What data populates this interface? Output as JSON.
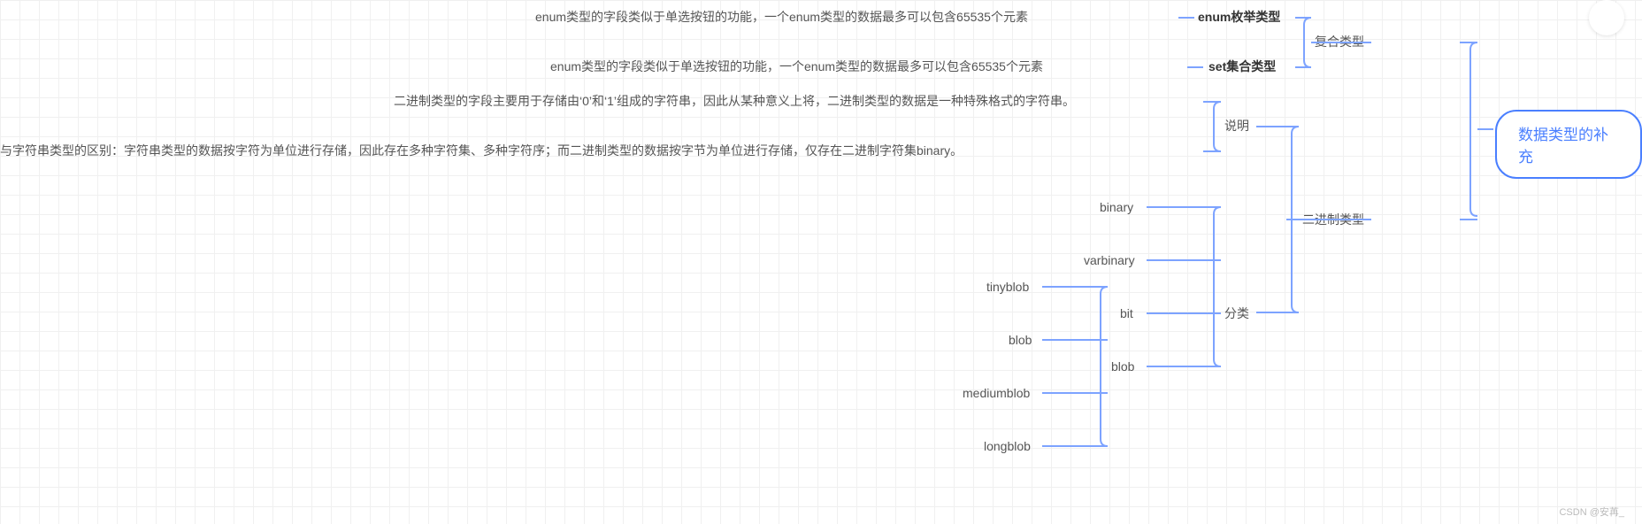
{
  "root": "数据类型的补充",
  "composite": {
    "label": "复合类型",
    "enum": {
      "label": "enum枚举类型",
      "desc": "enum类型的字段类似于单选按钮的功能，一个enum类型的数据最多可以包含65535个元素"
    },
    "set": {
      "label": "set集合类型",
      "desc": "enum类型的字段类似于单选按钮的功能，一个enum类型的数据最多可以包含65535个元素"
    }
  },
  "binary": {
    "label": "二进制类型",
    "explain": {
      "label": "说明",
      "desc1": "二进制类型的字段主要用于存储由‘0’和‘1’组成的字符串，因此从某种意义上将，二进制类型的数据是一种特殊格式的字符串。",
      "desc2": "与字符串类型的区别：字符串类型的数据按字符为单位进行存储，因此存在多种字符集、多种字符序；而二进制类型的数据按字节为单位进行存储，仅存在二进制字符集binary。"
    },
    "classify": {
      "label": "分类",
      "items": {
        "binary": "binary",
        "varbinary": "varbinary",
        "bit": "bit",
        "blob": {
          "label": "blob",
          "items": {
            "tinyblob": "tinyblob",
            "blob": "blob",
            "mediumblob": "mediumblob",
            "longblob": "longblob"
          }
        }
      }
    }
  },
  "watermark": "CSDN @安苒_"
}
